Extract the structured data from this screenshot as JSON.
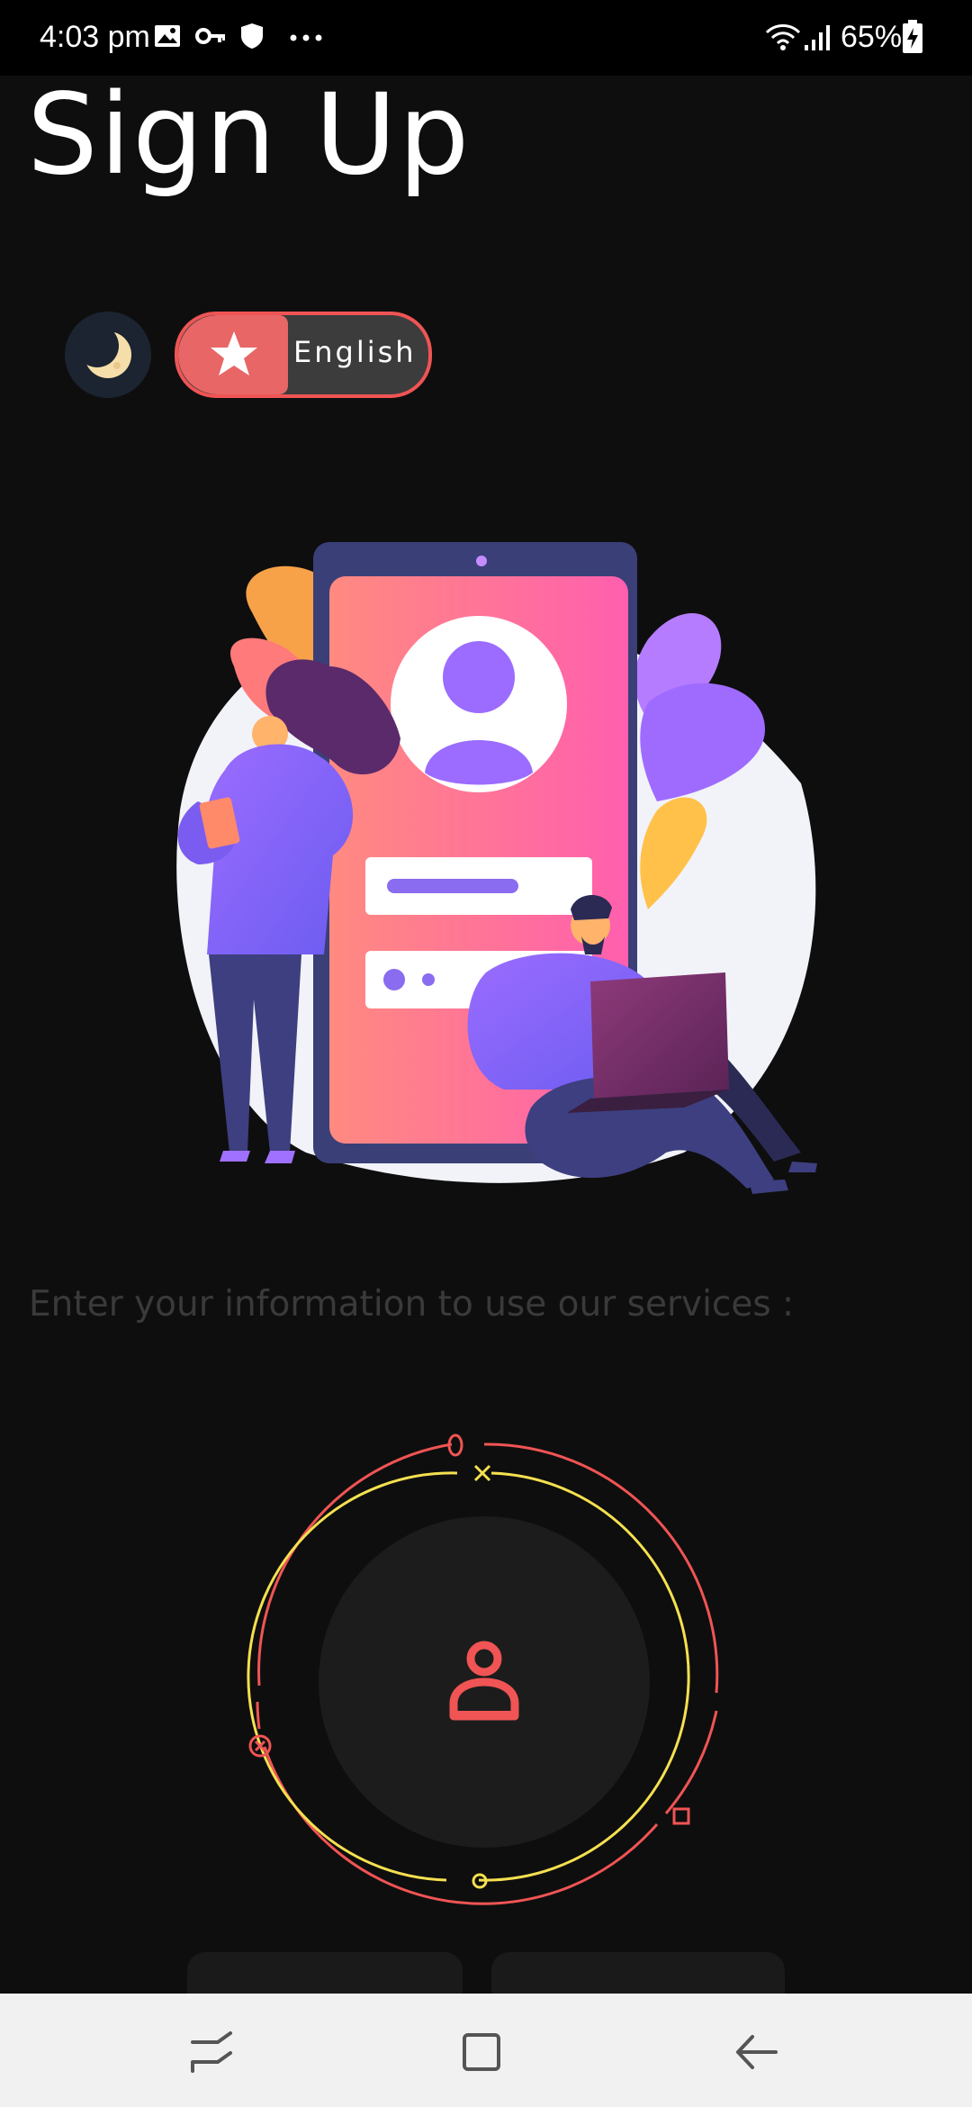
{
  "status_bar": {
    "time": "4:03 pm",
    "battery": "65%",
    "icons": [
      "image-icon",
      "key-icon",
      "shield-icon",
      "more-dots-icon",
      "wifi-icon",
      "signal-icon",
      "battery-icon"
    ]
  },
  "page": {
    "title": "Sign Up",
    "subtitle": "Enter your information to use our services :"
  },
  "controls": {
    "theme_icon": "moon-icon",
    "language_label": "English",
    "language_icon": "star-icon"
  },
  "colors": {
    "accent_red": "#f05454",
    "accent_yellow": "#f5e050",
    "background": "#0e0e0e"
  },
  "nav": {
    "icons": [
      "recent-apps-icon",
      "home-icon",
      "back-icon"
    ]
  }
}
